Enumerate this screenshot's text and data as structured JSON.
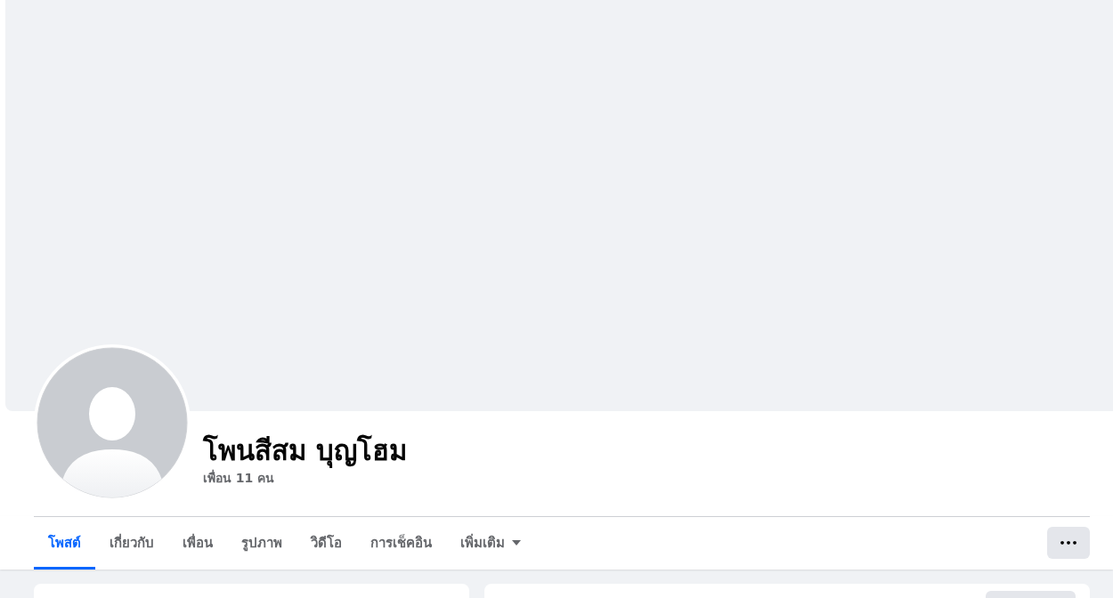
{
  "profile": {
    "name": "โพนสีสม บุญโฮม",
    "friends": "เพื่อน 11 คน"
  },
  "tabs": [
    {
      "label": "โพสต์",
      "selected": true,
      "kind": "tab"
    },
    {
      "label": "เกี่ยวกับ",
      "selected": false,
      "kind": "tab"
    },
    {
      "label": "เพื่อน",
      "selected": false,
      "kind": "tab"
    },
    {
      "label": "รูปภาพ",
      "selected": false,
      "kind": "tab"
    },
    {
      "label": "วิดีโอ",
      "selected": false,
      "kind": "tab"
    },
    {
      "label": "การเช็คอิน",
      "selected": false,
      "kind": "tab"
    },
    {
      "label": "เพิ่มเติม",
      "selected": false,
      "kind": "dropdown"
    }
  ],
  "more_button": {
    "label": "•••"
  }
}
